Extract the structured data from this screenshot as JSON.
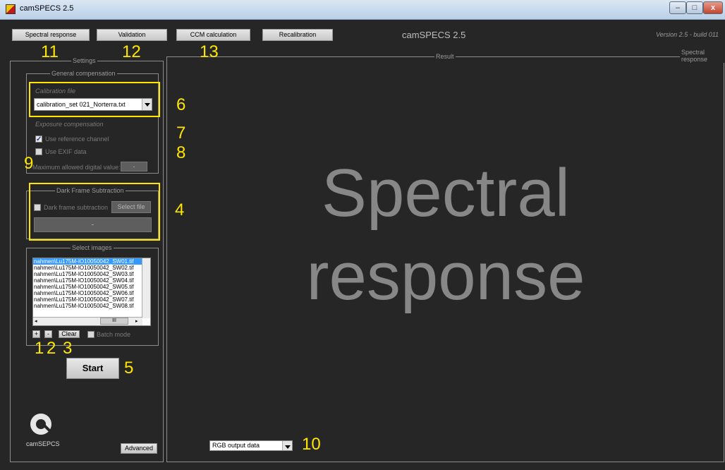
{
  "window": {
    "title": "camSPECS 2.5",
    "min": "–",
    "max": "□",
    "close": "x"
  },
  "toolbar": {
    "tabs": [
      "Spectral response",
      "Validation",
      "CCM calculation",
      "Recalibration"
    ],
    "app_name": "camSPECS 2.5",
    "version": "Version 2.5 - build 011"
  },
  "settings": {
    "legend": "Settings",
    "general": {
      "legend": "General compensation",
      "calibration_label": "Calibration file",
      "calibration_value": "calibration_set 021_Norterra.txt",
      "exposure_label": "Exposure compensation",
      "use_reference": "Use reference channel",
      "use_exif": "Use EXIF data",
      "max_label": "Maximum allowed digital value:",
      "max_value": "-"
    },
    "dark": {
      "legend": "Dark Frame Subtraction",
      "checkbox_label": "Dark frame subtraction",
      "select_file": "Select file",
      "file_value": "-"
    },
    "images": {
      "legend": "Select images",
      "files": [
        "nahmen\\Lu175M-IO10050042_SW01.tif",
        "nahmen\\Lu175M-IO10050042_SW02.tif",
        "nahmen\\Lu175M-IO10050042_SW03.tif",
        "nahmen\\Lu175M-IO10050042_SW04.tif",
        "nahmen\\Lu175M-IO10050042_SW05.tif",
        "nahmen\\Lu175M-IO10050042_SW06.tif",
        "nahmen\\Lu175M-IO10050042_SW07.tif",
        "nahmen\\Lu175M-IO10050042_SW08.tif"
      ],
      "add": "+",
      "remove": "-",
      "clear": "Clear",
      "batch": "Batch mode",
      "hscroll_thumb": "III"
    },
    "start": "Start",
    "logo_text": "camSEPCS",
    "advanced": "Advanced"
  },
  "result": {
    "legend": "Result",
    "mode_legend": "Spectral response",
    "big_line1": "Spectral",
    "big_line2": "response",
    "output_select": "RGB output data"
  },
  "annotations": {
    "n1": "1",
    "n2": "2",
    "n3": "3",
    "n4": "4",
    "n5": "5",
    "n6": "6",
    "n7": "7",
    "n8": "8",
    "n9": "9",
    "n10": "10",
    "n11": "11",
    "n12": "12",
    "n13": "13"
  },
  "colors": {
    "background": "#262626",
    "annotation": "#ffe600",
    "selection": "#3399ff"
  }
}
